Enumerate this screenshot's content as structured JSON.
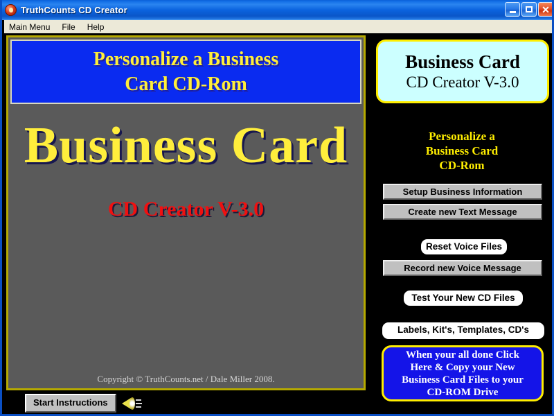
{
  "window": {
    "title": "TruthCounts CD Creator",
    "app_icon": "cd-disc-icon",
    "buttons": {
      "minimize": "minimize-icon",
      "maximize": "maximize-icon",
      "close": "close-icon"
    }
  },
  "menu": {
    "items": [
      {
        "label": "Main Menu"
      },
      {
        "label": "File"
      },
      {
        "label": "Help"
      }
    ]
  },
  "left_panel": {
    "header": {
      "line1": "Personalize a Business",
      "line2": "Card CD-Rom"
    },
    "big_title": "Business Card",
    "big_subtitle": "CD Creator V-3.0",
    "copyright": "Copyright © TruthCounts.net / Dale Miller  2008."
  },
  "bottom_bar": {
    "start_instructions_label": "Start Instructions",
    "speaker_icon": "speaker-icon"
  },
  "right_panel": {
    "product_card": {
      "title": "Business Card",
      "subtitle": "CD Creator V-3.0"
    },
    "personalize": {
      "line1": "Personalize a",
      "line2": "Business Card",
      "line3": "CD-Rom"
    },
    "buttons": {
      "setup_business": "Setup Business Information",
      "create_text": "Create new Text Message",
      "reset_voice": "Reset Voice Files",
      "record_voice": "Record new Voice Message",
      "test_cd": "Test Your New CD Files",
      "labels_kits": "Labels,  Kit's, Templates, CD's"
    },
    "finish_box": {
      "line1": "When your all done Click",
      "line2": "Here & Copy your New",
      "line3": "Business Card Files to your",
      "line4": "CD-ROM Drive"
    }
  },
  "colors": {
    "titlebar_blue": "#0b63de",
    "menu_bg": "#ece9d8",
    "panel_gray": "#5a5a5a",
    "accent_yellow": "#ffee00",
    "header_blue": "#0a2bf0",
    "title_yellow": "#ffee3c",
    "subtitle_red": "#f01010",
    "card_cyan": "#ccffff",
    "button_gray": "#c0c0c0"
  }
}
